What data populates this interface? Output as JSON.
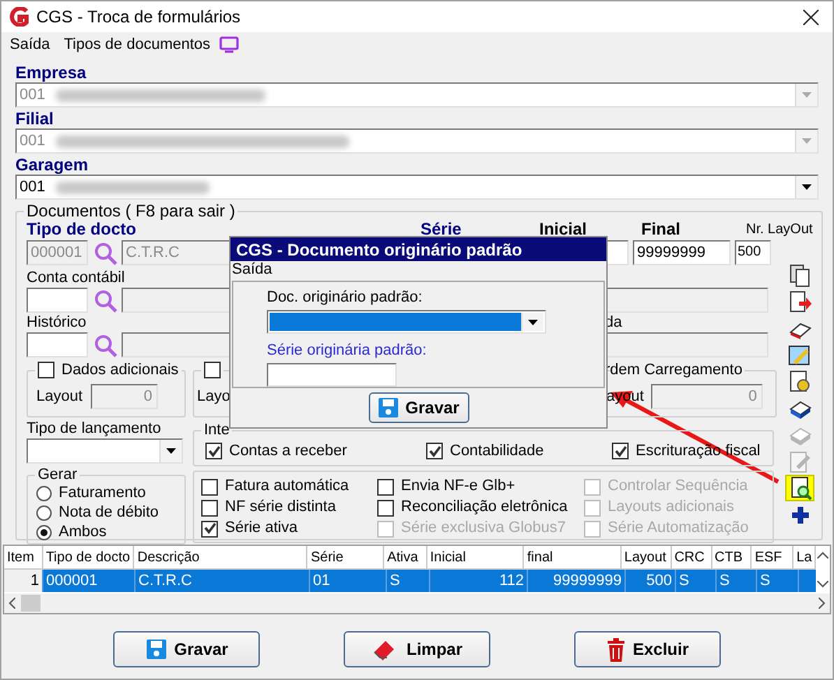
{
  "window": {
    "title": "CGS - Troca de formulários"
  },
  "menu": [
    {
      "label": "Saída"
    },
    {
      "label": "Tipos de documentos"
    }
  ],
  "company_fields": [
    {
      "label": "Empresa",
      "value": "001",
      "disabled": true
    },
    {
      "label": "Filial",
      "value": "001",
      "disabled": true
    },
    {
      "label": "Garagem",
      "value": "001",
      "disabled": false
    }
  ],
  "documents": {
    "legend": "Documentos ( F8 para sair )",
    "tipo_docto": {
      "label": "Tipo de docto",
      "code": "000001",
      "description": "C.T.R.C"
    },
    "serie_label": "Série",
    "inicial_label": "Inicial",
    "final": {
      "label": "Final",
      "value": "99999999"
    },
    "nr_layout": {
      "label": "Nr. LayOut",
      "value": "500"
    },
    "conta_contabil": {
      "label": "Conta contábil"
    },
    "historico": {
      "label": "Histórico"
    },
    "partial_label": "da",
    "dados_adicionais": {
      "label": "Dados adicionais",
      "checked": false,
      "layout_label": "Layout",
      "layout_value": "0"
    },
    "group_2": {
      "checked": false,
      "layout_label": "Layo"
    },
    "ordem_carregamento": {
      "label": "rdem Carregamento",
      "layout_label": "ayout",
      "layout_value": "0"
    },
    "tipo_lancamento": {
      "label": "Tipo de lançamento"
    },
    "integracao": {
      "legend": "Inte",
      "options": [
        {
          "label": "Contas a receber",
          "checked": true
        },
        {
          "label": "Contabilidade",
          "checked": true
        },
        {
          "label": "Escrituração fiscal",
          "checked": true
        }
      ]
    },
    "gerar": {
      "legend": "Gerar",
      "options": [
        {
          "label": "Faturamento",
          "selected": false
        },
        {
          "label": "Nota de débito",
          "selected": false
        },
        {
          "label": "Ambos",
          "selected": true
        }
      ]
    },
    "options": [
      [
        {
          "label": "Fatura automática",
          "checked": false,
          "disabled": false
        },
        {
          "label": "NF série distinta",
          "checked": false,
          "disabled": false
        },
        {
          "label": "Série ativa",
          "checked": true,
          "disabled": false
        }
      ],
      [
        {
          "label": "Envia NF-e Glb+",
          "checked": false,
          "disabled": false
        },
        {
          "label": "Reconciliação eletrônica",
          "checked": false,
          "disabled": false
        },
        {
          "label": "Série exclusiva Globus7",
          "checked": false,
          "disabled": true
        }
      ],
      [
        {
          "label": "Controlar Sequência",
          "checked": false,
          "disabled": true
        },
        {
          "label": "Layouts adicionais",
          "checked": false,
          "disabled": true
        },
        {
          "label": "Série Automatização",
          "checked": false,
          "disabled": true
        }
      ]
    ],
    "toolbar": [
      {
        "kind": "copy",
        "disabled": false,
        "highlighted": false
      },
      {
        "kind": "export",
        "disabled": false,
        "highlighted": false
      },
      {
        "kind": "eraser",
        "disabled": false,
        "highlighted": false
      },
      {
        "kind": "picture",
        "disabled": false,
        "highlighted": false
      },
      {
        "kind": "report",
        "disabled": false,
        "highlighted": false
      },
      {
        "kind": "print",
        "disabled": false,
        "highlighted": false
      },
      {
        "kind": "print",
        "disabled": true,
        "highlighted": false
      },
      {
        "kind": "edit",
        "disabled": true,
        "highlighted": false
      },
      {
        "kind": "preview",
        "disabled": false,
        "highlighted": true
      },
      {
        "kind": "add",
        "disabled": false,
        "highlighted": false
      }
    ]
  },
  "table": {
    "columns": [
      "Item",
      "Tipo de docto",
      "Descrição",
      "Série",
      "Ativa",
      "Inicial",
      "final",
      "Layout",
      "CRC",
      "CTB",
      "ESF",
      "La"
    ],
    "rows": [
      {
        "selected": true,
        "cells": [
          "1",
          "000001",
          "C.T.R.C",
          "01",
          "S",
          "112",
          "99999999",
          "500",
          "S",
          "S",
          "S"
        ]
      }
    ]
  },
  "buttons": [
    {
      "label": "Gravar",
      "kind": "save"
    },
    {
      "label": "Limpar",
      "kind": "clear"
    },
    {
      "label": "Excluir",
      "kind": "delete"
    }
  ],
  "dialog": {
    "title": "CGS - Documento originário padrão",
    "menu": "Saída",
    "doc_label": "Doc. originário padrão:",
    "serie_label": "Série originária padrão:",
    "button": "Gravar"
  }
}
